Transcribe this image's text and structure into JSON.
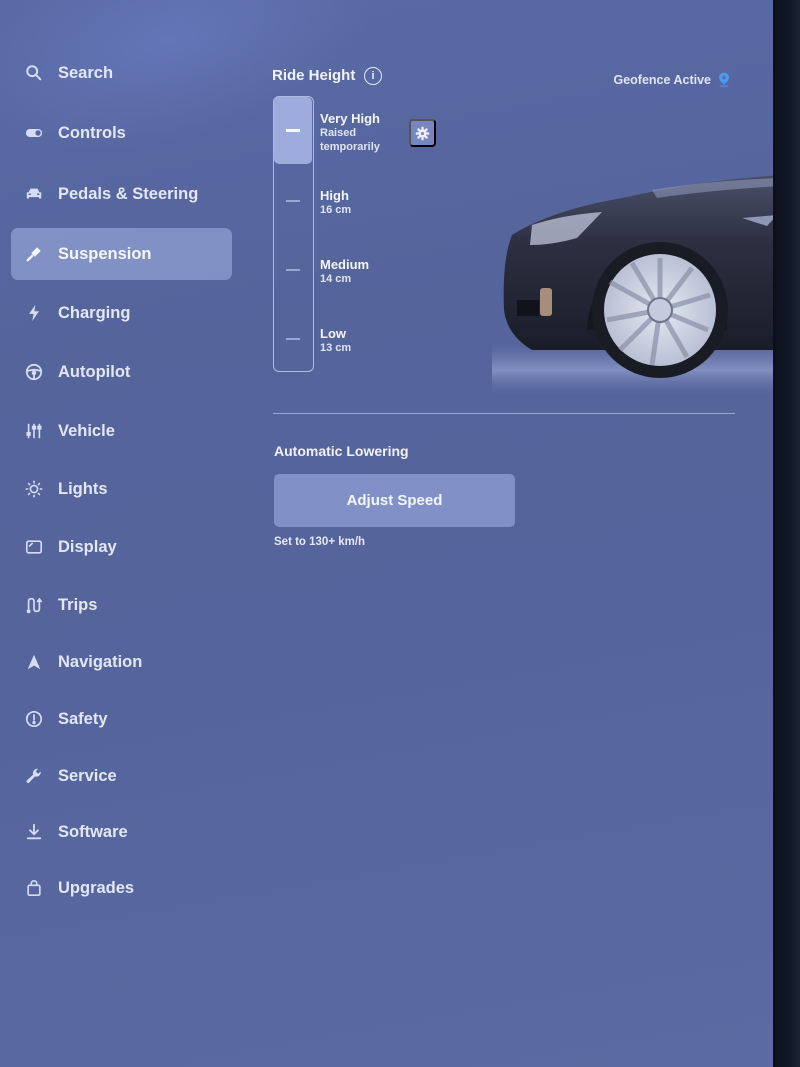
{
  "sidebar": {
    "items": [
      {
        "label": "Search",
        "icon": "search-icon",
        "active": false
      },
      {
        "label": "Controls",
        "icon": "toggle-icon",
        "active": false
      },
      {
        "label": "Pedals & Steering",
        "icon": "car-icon",
        "active": false
      },
      {
        "label": "Suspension",
        "icon": "shock-absorber-icon",
        "active": true
      },
      {
        "label": "Charging",
        "icon": "lightning-icon",
        "active": false
      },
      {
        "label": "Autopilot",
        "icon": "steering-wheel-icon",
        "active": false
      },
      {
        "label": "Vehicle",
        "icon": "sliders-icon",
        "active": false
      },
      {
        "label": "Lights",
        "icon": "sun-icon",
        "active": false
      },
      {
        "label": "Display",
        "icon": "display-icon",
        "active": false
      },
      {
        "label": "Trips",
        "icon": "route-icon",
        "active": false
      },
      {
        "label": "Navigation",
        "icon": "navigation-arrow-icon",
        "active": false
      },
      {
        "label": "Safety",
        "icon": "alert-circle-icon",
        "active": false
      },
      {
        "label": "Service",
        "icon": "wrench-icon",
        "active": false
      },
      {
        "label": "Software",
        "icon": "download-icon",
        "active": false
      },
      {
        "label": "Upgrades",
        "icon": "shopping-bag-icon",
        "active": false
      }
    ]
  },
  "ride_height": {
    "title": "Ride Height",
    "info_icon": "info-icon",
    "selected_index": 0,
    "levels": [
      {
        "name": "Very High",
        "detail": "Raised temporarily"
      },
      {
        "name": "High",
        "detail": "16 cm"
      },
      {
        "name": "Medium",
        "detail": "14 cm"
      },
      {
        "name": "Low",
        "detail": "13 cm"
      }
    ],
    "settings_icon": "gear-icon"
  },
  "geofence": {
    "label": "Geofence Active",
    "icon": "location-pin-icon",
    "icon_color": "#4a9cf0"
  },
  "automatic_lowering": {
    "title": "Automatic Lowering",
    "button_label": "Adjust Speed",
    "hint": "Set to 130+ km/h"
  }
}
